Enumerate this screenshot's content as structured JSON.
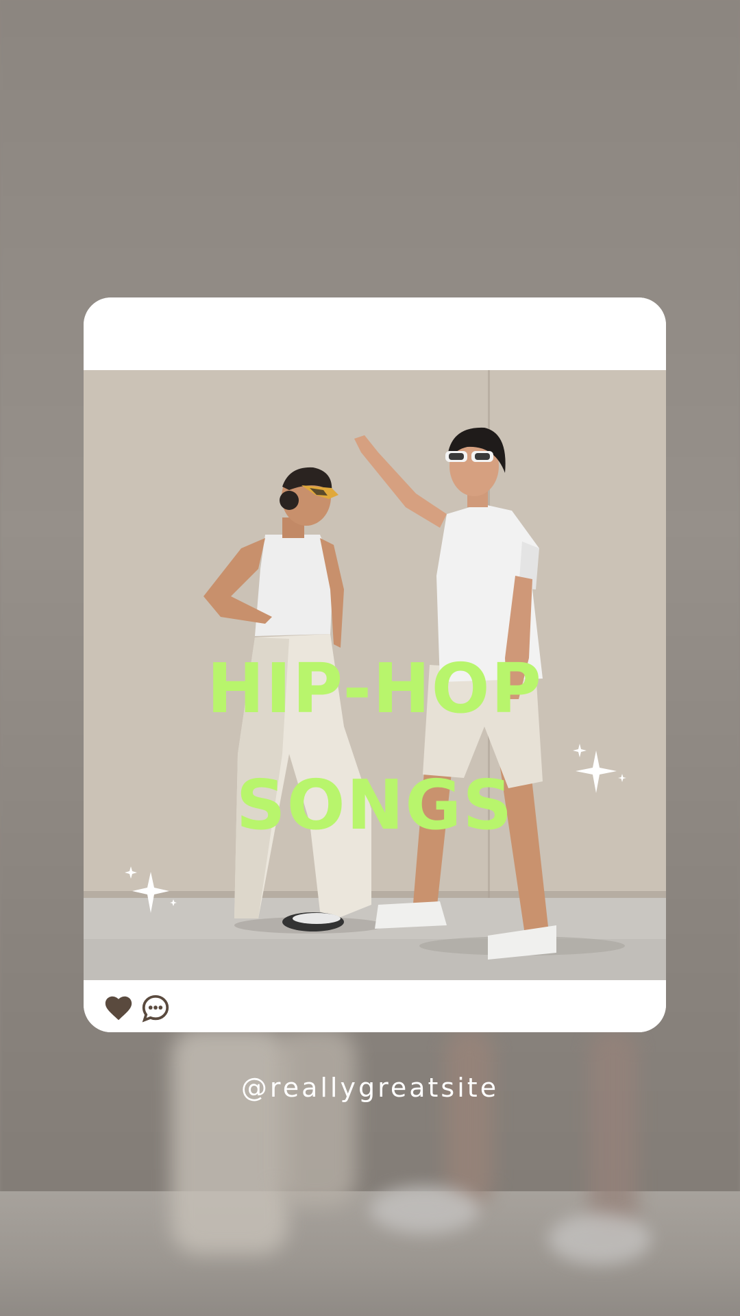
{
  "title": {
    "line1": "HIP-HOP",
    "line2": "SONGS"
  },
  "handle": "@reallygreatsite",
  "actions": {
    "like_icon": "heart-icon",
    "comment_icon": "comment-bubble-icon"
  },
  "colors": {
    "title": "#b8f56c",
    "card": "#ffffff",
    "icon": "#5a4a3e",
    "background": "#8f8882"
  }
}
